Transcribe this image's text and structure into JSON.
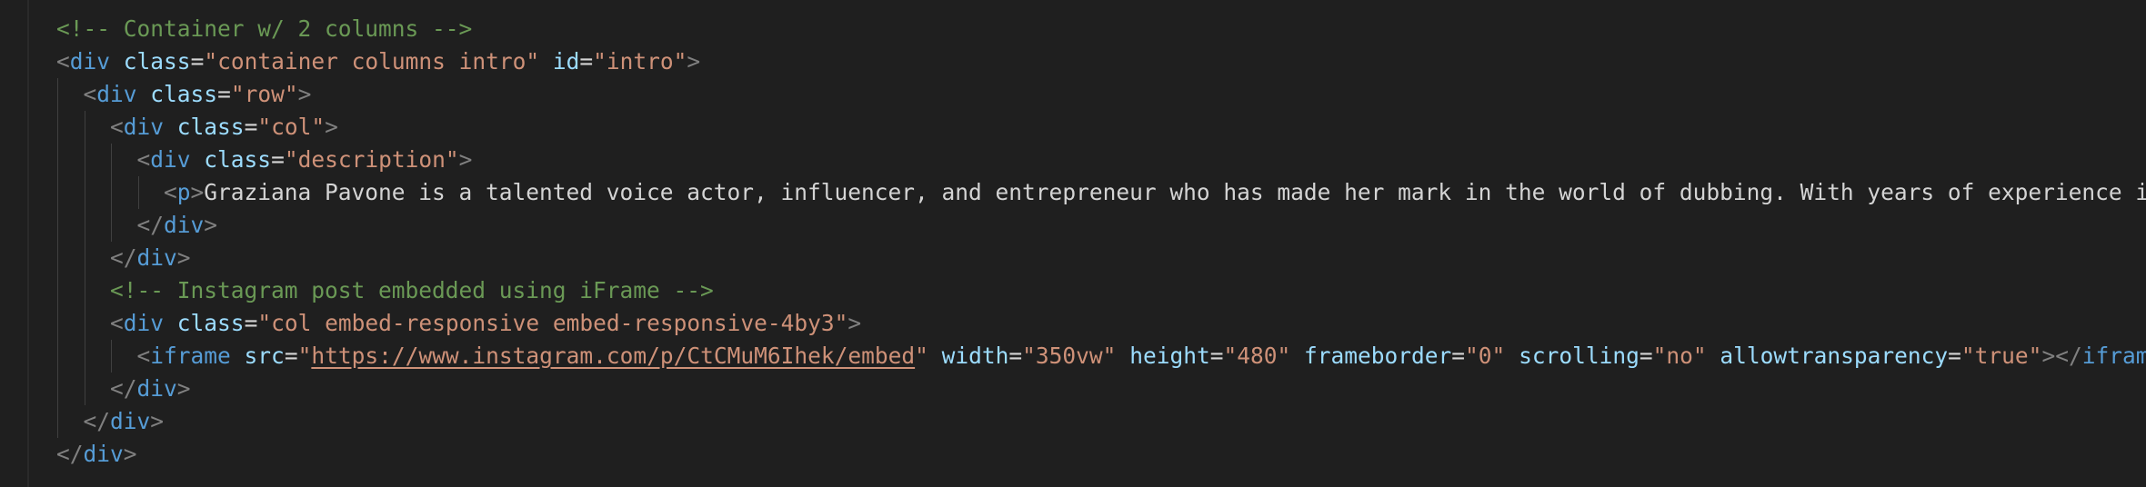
{
  "editor": {
    "language": "html",
    "theme_colors": {
      "background": "#1f1f1f",
      "punctuation": "#808080",
      "tag": "#569cd6",
      "attribute": "#9cdcfe",
      "string": "#ce9178",
      "text": "#d4d4d4",
      "comment": "#6a9955"
    },
    "lines": [
      {
        "indent": 0,
        "tokens": [
          {
            "t": "comment",
            "v": "<!-- Container w/ 2 columns -->"
          }
        ]
      },
      {
        "indent": 0,
        "tokens": [
          {
            "t": "punct",
            "v": "<"
          },
          {
            "t": "tag",
            "v": "div"
          },
          {
            "t": "text",
            "v": " "
          },
          {
            "t": "attr",
            "v": "class"
          },
          {
            "t": "text",
            "v": "="
          },
          {
            "t": "str",
            "v": "\"container columns intro\""
          },
          {
            "t": "text",
            "v": " "
          },
          {
            "t": "attr",
            "v": "id"
          },
          {
            "t": "text",
            "v": "="
          },
          {
            "t": "str",
            "v": "\"intro\""
          },
          {
            "t": "punct",
            "v": ">"
          }
        ]
      },
      {
        "indent": 1,
        "tokens": [
          {
            "t": "punct",
            "v": "<"
          },
          {
            "t": "tag",
            "v": "div"
          },
          {
            "t": "text",
            "v": " "
          },
          {
            "t": "attr",
            "v": "class"
          },
          {
            "t": "text",
            "v": "="
          },
          {
            "t": "str",
            "v": "\"row\""
          },
          {
            "t": "punct",
            "v": ">"
          }
        ]
      },
      {
        "indent": 2,
        "tokens": [
          {
            "t": "punct",
            "v": "<"
          },
          {
            "t": "tag",
            "v": "div"
          },
          {
            "t": "text",
            "v": " "
          },
          {
            "t": "attr",
            "v": "class"
          },
          {
            "t": "text",
            "v": "="
          },
          {
            "t": "str",
            "v": "\"col\""
          },
          {
            "t": "punct",
            "v": ">"
          }
        ]
      },
      {
        "indent": 3,
        "tokens": [
          {
            "t": "punct",
            "v": "<"
          },
          {
            "t": "tag",
            "v": "div"
          },
          {
            "t": "text",
            "v": " "
          },
          {
            "t": "attr",
            "v": "class"
          },
          {
            "t": "text",
            "v": "="
          },
          {
            "t": "str",
            "v": "\"description\""
          },
          {
            "t": "punct",
            "v": ">"
          }
        ]
      },
      {
        "indent": 4,
        "tokens": [
          {
            "t": "punct",
            "v": "<"
          },
          {
            "t": "tag",
            "v": "p"
          },
          {
            "t": "punct",
            "v": ">"
          },
          {
            "t": "text",
            "v": "Graziana Pavone is a talented voice actor, influencer, and entrepreneur who has made her mark in the world of dubbing. With years of experience in a"
          }
        ]
      },
      {
        "indent": 3,
        "tokens": [
          {
            "t": "punct",
            "v": "</"
          },
          {
            "t": "tag",
            "v": "div"
          },
          {
            "t": "punct",
            "v": ">"
          }
        ]
      },
      {
        "indent": 2,
        "tokens": [
          {
            "t": "punct",
            "v": "</"
          },
          {
            "t": "tag",
            "v": "div"
          },
          {
            "t": "punct",
            "v": ">"
          }
        ]
      },
      {
        "indent": 2,
        "tokens": [
          {
            "t": "comment",
            "v": "<!-- Instagram post embedded using iFrame -->"
          }
        ]
      },
      {
        "indent": 2,
        "tokens": [
          {
            "t": "punct",
            "v": "<"
          },
          {
            "t": "tag",
            "v": "div"
          },
          {
            "t": "text",
            "v": " "
          },
          {
            "t": "attr",
            "v": "class"
          },
          {
            "t": "text",
            "v": "="
          },
          {
            "t": "str",
            "v": "\"col embed-responsive embed-responsive-4by3\""
          },
          {
            "t": "punct",
            "v": ">"
          }
        ]
      },
      {
        "indent": 3,
        "tokens": [
          {
            "t": "punct",
            "v": "<"
          },
          {
            "t": "tag",
            "v": "iframe"
          },
          {
            "t": "text",
            "v": " "
          },
          {
            "t": "attr",
            "v": "src"
          },
          {
            "t": "text",
            "v": "="
          },
          {
            "t": "str",
            "v": "\""
          },
          {
            "t": "url",
            "v": "https://www.instagram.com/p/CtCMuM6Ihek/embed"
          },
          {
            "t": "str",
            "v": "\""
          },
          {
            "t": "text",
            "v": " "
          },
          {
            "t": "attr",
            "v": "width"
          },
          {
            "t": "text",
            "v": "="
          },
          {
            "t": "str",
            "v": "\"350vw\""
          },
          {
            "t": "text",
            "v": " "
          },
          {
            "t": "attr",
            "v": "height"
          },
          {
            "t": "text",
            "v": "="
          },
          {
            "t": "str",
            "v": "\"480\""
          },
          {
            "t": "text",
            "v": " "
          },
          {
            "t": "attr",
            "v": "frameborder"
          },
          {
            "t": "text",
            "v": "="
          },
          {
            "t": "str",
            "v": "\"0\""
          },
          {
            "t": "text",
            "v": " "
          },
          {
            "t": "attr",
            "v": "scrolling"
          },
          {
            "t": "text",
            "v": "="
          },
          {
            "t": "str",
            "v": "\"no\""
          },
          {
            "t": "text",
            "v": " "
          },
          {
            "t": "attr",
            "v": "allowtransparency"
          },
          {
            "t": "text",
            "v": "="
          },
          {
            "t": "str",
            "v": "\"true\""
          },
          {
            "t": "punct",
            "v": "></"
          },
          {
            "t": "tag",
            "v": "iframe"
          },
          {
            "t": "punct",
            "v": ">"
          }
        ]
      },
      {
        "indent": 2,
        "tokens": [
          {
            "t": "punct",
            "v": "</"
          },
          {
            "t": "tag",
            "v": "div"
          },
          {
            "t": "punct",
            "v": ">"
          }
        ]
      },
      {
        "indent": 1,
        "tokens": [
          {
            "t": "punct",
            "v": "</"
          },
          {
            "t": "tag",
            "v": "div"
          },
          {
            "t": "punct",
            "v": ">"
          }
        ]
      },
      {
        "indent": 0,
        "tokens": [
          {
            "t": "punct",
            "v": "</"
          },
          {
            "t": "tag",
            "v": "div"
          },
          {
            "t": "punct",
            "v": ">"
          }
        ]
      }
    ]
  }
}
